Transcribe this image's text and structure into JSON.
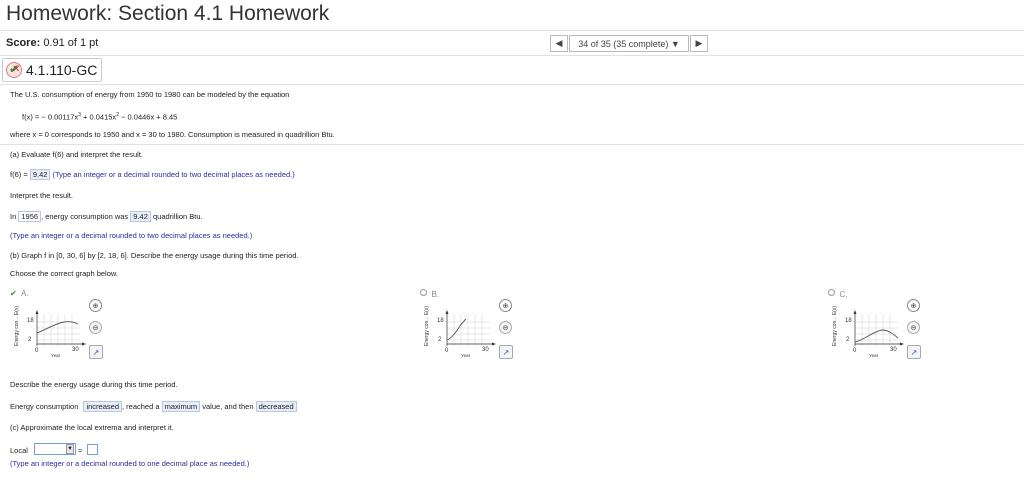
{
  "header": {
    "title": "Homework: Section 4.1 Homework"
  },
  "score": {
    "label": "Score:",
    "value": "0.91 of 1 pt"
  },
  "nav": {
    "prev_icon": "◀",
    "progress": "34 of 35 (35 complete) ▼",
    "next_icon": "▶"
  },
  "question": {
    "id": "4.1.110-GC",
    "status_icon": "partial-credit-icon"
  },
  "problem": {
    "intro": "The U.S. consumption of energy from 1950 to 1980 can be modeled by the equation",
    "equation_prefix": "f(x) = − 0.00117x",
    "eq_exp1": "3",
    "eq_mid": " + 0.0415x",
    "eq_exp2": "2",
    "eq_tail": " − 0.0446x + 8.45",
    "where": "where x = 0 corresponds to 1950 and x = 30 to 1980. Consumption is measured in quadrillion Btu."
  },
  "part_a": {
    "prompt": "(a) Evaluate f(6) and interpret the result.",
    "answer_prefix": "f(6) =",
    "answer_value": "9.42",
    "answer_hint": "(Type an integer or a decimal rounded to two decimal places as needed.)",
    "interpret_label": "Interpret the result.",
    "interp_1": "In",
    "interp_year": "1956",
    "interp_2": ", energy consumption was",
    "interp_value": "9.42",
    "interp_3": "quadrillion Btu.",
    "interp_hint": "(Type an integer or a decimal rounded to two decimal places as needed.)"
  },
  "part_b": {
    "prompt": "(b) Graph f in [0, 30, 6] by [2, 18, 6]. Describe the energy usage during this time period.",
    "choose": "Choose the correct graph below.",
    "options": [
      {
        "label": "A.",
        "selected": true
      },
      {
        "label": "B.",
        "selected": false
      },
      {
        "label": "C.",
        "selected": false
      }
    ],
    "graph_ylabel": "Energy con... E(x)",
    "graph_xlabel": "Year",
    "graph_ytick_top": "18",
    "graph_ytick_bottom": "2",
    "graph_xtick_left": "0",
    "graph_xtick_right": "30",
    "describe_label": "Describe the energy usage during this time period.",
    "desc_1": "Energy consumption",
    "desc_ans1": "increased",
    "desc_2": ", reached a",
    "desc_ans2": "maximum",
    "desc_3": "value, and then",
    "desc_ans3": "decreased"
  },
  "part_c": {
    "prompt": "(c) Approximate the local extrema and interpret it.",
    "local_label": "Local",
    "approx_symbol": "≈",
    "hint": "(Type an integer or a decimal rounded to one decimal place as needed.)"
  },
  "icons": {
    "zoom_in": "⊕",
    "zoom_out": "⊖",
    "popout": "↗",
    "dropdown": "▼",
    "check": "✔"
  },
  "colors": {
    "hint_blue": "#2c2c9e",
    "answer_bg": "#e7eef9",
    "correct_green": "#2f8f2f"
  }
}
